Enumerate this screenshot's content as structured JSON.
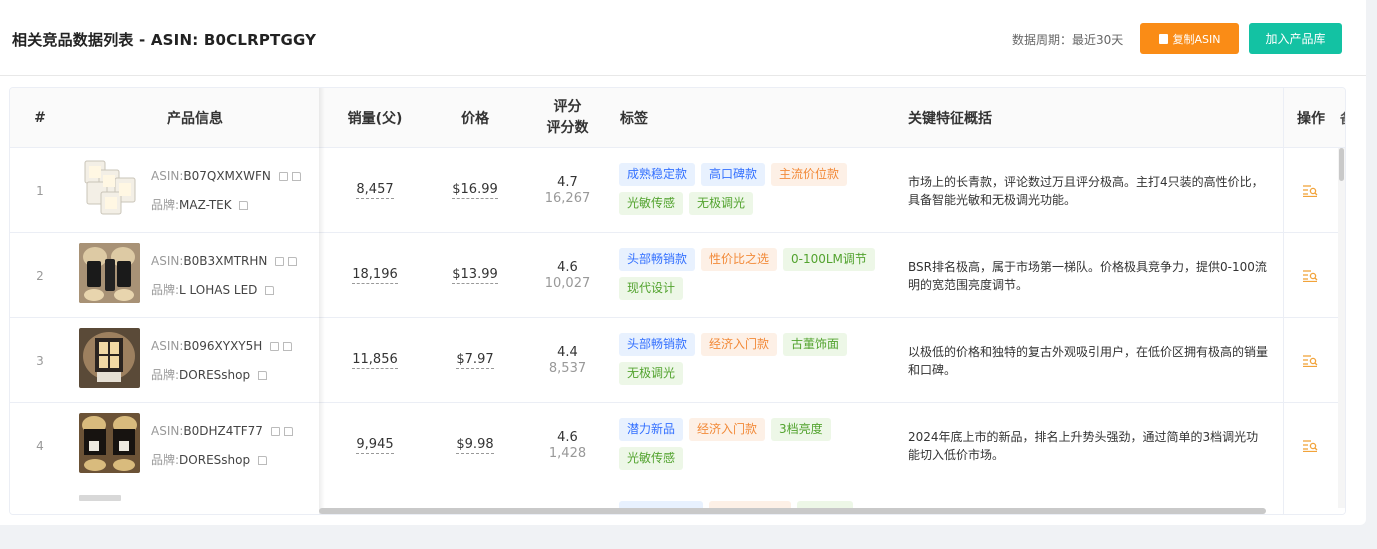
{
  "header": {
    "title": "相关竞品数据列表 - ASIN: B0CLRPTGGY",
    "period": "数据周期：最近30天",
    "copy_button": "复制ASIN",
    "add_button": "加入产品库"
  },
  "table": {
    "columns": {
      "index": "#",
      "product": "产品信息",
      "sales": "销量(父)",
      "price": "价格",
      "rating_top": "评分",
      "rating_bottom": "评分数",
      "tags": "标签",
      "summary": "关键特征概括",
      "action": "操作",
      "extra": "备"
    },
    "asin_prefix": "ASIN:",
    "brand_prefix": "品牌:",
    "rows": [
      {
        "index": "1",
        "asin": "B07QXMXWFN",
        "brand": "MAZ-TEK",
        "sales": "8,457",
        "price": "$16.99",
        "rating": "4.7",
        "rating_count": "16,267",
        "tags": [
          {
            "label": "成熟稳定款",
            "color": "blue"
          },
          {
            "label": "高口碑款",
            "color": "blue"
          },
          {
            "label": "主流价位款",
            "color": "orange"
          },
          {
            "label": "光敏传感",
            "color": "green"
          },
          {
            "label": "无极调光",
            "color": "green"
          }
        ],
        "summary": "市场上的长青款，评论数过万且评分极高。主打4只装的高性价比，具备智能光敏和无极调光功能。"
      },
      {
        "index": "2",
        "asin": "B0B3XMTRHN",
        "brand": "L LOHAS LED",
        "sales": "18,196",
        "price": "$13.99",
        "rating": "4.6",
        "rating_count": "10,027",
        "tags": [
          {
            "label": "头部畅销款",
            "color": "blue"
          },
          {
            "label": "性价比之选",
            "color": "orange"
          },
          {
            "label": "0-100LM调节",
            "color": "green"
          },
          {
            "label": "现代设计",
            "color": "green"
          }
        ],
        "summary": "BSR排名极高，属于市场第一梯队。价格极具竞争力，提供0-100流明的宽范围亮度调节。"
      },
      {
        "index": "3",
        "asin": "B096XYXY5H",
        "brand": "DORESshop",
        "sales": "11,856",
        "price": "$7.97",
        "rating": "4.4",
        "rating_count": "8,537",
        "tags": [
          {
            "label": "头部畅销款",
            "color": "blue"
          },
          {
            "label": "经济入门款",
            "color": "orange"
          },
          {
            "label": "古董饰面",
            "color": "green"
          },
          {
            "label": "无极调光",
            "color": "green"
          }
        ],
        "summary": "以极低的价格和独特的复古外观吸引用户，在低价区拥有极高的销量和口碑。"
      },
      {
        "index": "4",
        "asin": "B0DHZ4TF77",
        "brand": "DORESshop",
        "sales": "9,945",
        "price": "$9.98",
        "rating": "4.6",
        "rating_count": "1,428",
        "tags": [
          {
            "label": "潜力新品",
            "color": "blue"
          },
          {
            "label": "经济入门款",
            "color": "orange"
          },
          {
            "label": "3档亮度",
            "color": "green"
          },
          {
            "label": "光敏传感",
            "color": "green"
          }
        ],
        "summary": "2024年底上市的新品，排名上升势头强劲，通过简单的3档调光功能切入低价市场。"
      }
    ]
  },
  "colors": {
    "copy_button": "#fa8c16",
    "add_button": "#13c2a3",
    "tag_blue": "#3370ff",
    "tag_orange": "#f28a39",
    "tag_green": "#52a32e",
    "action_icon": "#f2a33a"
  },
  "icons": {
    "copy_button_icon": "document-copy-icon",
    "asin_copy": "copy-icon",
    "asin_link": "external-link-icon",
    "action": "detail-list-icon"
  }
}
